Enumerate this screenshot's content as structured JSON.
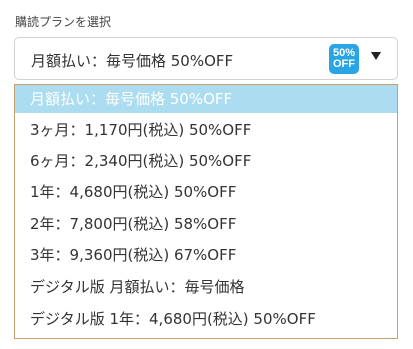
{
  "field_label": "購読プランを選択",
  "select": {
    "value": "月額払い：毎号価格 50%OFF",
    "badge_line1": "50%",
    "badge_line2": "OFF",
    "chevron_icon": "chevron-down-icon"
  },
  "options": [
    {
      "label": "月額払い：毎号価格 50%OFF",
      "selected": true
    },
    {
      "label": "3ヶ月：1,170円(税込) 50%OFF",
      "selected": false
    },
    {
      "label": "6ヶ月：2,340円(税込) 50%OFF",
      "selected": false
    },
    {
      "label": "1年：4,680円(税込) 50%OFF",
      "selected": false
    },
    {
      "label": "2年：7,800円(税込) 58%OFF",
      "selected": false
    },
    {
      "label": "3年：9,360円(税込) 67%OFF",
      "selected": false
    },
    {
      "label": "デジタル版 月額払い：毎号価格",
      "selected": false
    },
    {
      "label": "デジタル版 1年：4,680円(税込) 50%OFF",
      "selected": false
    }
  ],
  "colors": {
    "badge": "#2aa5e4",
    "selected_option_bg": "#acdcef",
    "dropdown_border": "#c8a070"
  }
}
